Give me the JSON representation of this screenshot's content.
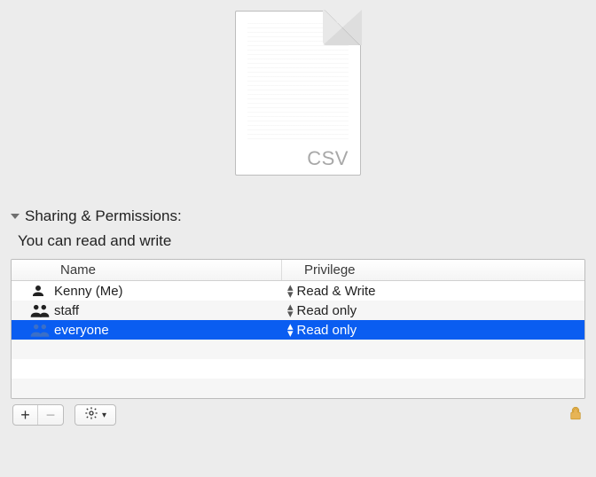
{
  "preview": {
    "file_type_label": "CSV"
  },
  "section": {
    "title": "Sharing & Permissions:",
    "subtitle": "You can read and write"
  },
  "table": {
    "columns": {
      "name": "Name",
      "privilege": "Privilege"
    },
    "rows": [
      {
        "icon": "person",
        "name": "Kenny (Me)",
        "privilege": "Read & Write",
        "selected": false
      },
      {
        "icon": "group",
        "name": "staff",
        "privilege": "Read only",
        "selected": false
      },
      {
        "icon": "group",
        "name": "everyone",
        "privilege": "Read only",
        "selected": true
      }
    ]
  },
  "footer": {
    "add_label": "+",
    "remove_label": "−"
  }
}
